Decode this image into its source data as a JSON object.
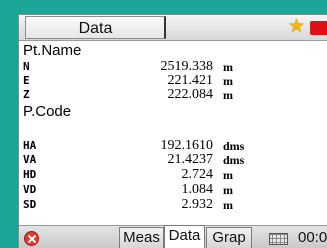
{
  "window": {
    "title": "Data"
  },
  "labels": {
    "pt_name": "Pt.Name",
    "p_code": "P.Code"
  },
  "coords": [
    {
      "key": "N",
      "value": "2519.338",
      "unit": "m"
    },
    {
      "key": "E",
      "value": "221.421",
      "unit": "m"
    },
    {
      "key": "Z",
      "value": "222.084",
      "unit": "m"
    }
  ],
  "measurements": [
    {
      "key": "HA",
      "value": "192.1610",
      "unit": "dms"
    },
    {
      "key": "VA",
      "value": "21.4237",
      "unit": "dms"
    },
    {
      "key": "HD",
      "value": "2.724",
      "unit": "m"
    },
    {
      "key": "VD",
      "value": "1.084",
      "unit": "m"
    },
    {
      "key": "SD",
      "value": "2.932",
      "unit": "m"
    }
  ],
  "tabs": [
    {
      "label": "Meas",
      "active": false
    },
    {
      "label": "Data",
      "active": true
    },
    {
      "label": "Grap",
      "active": false
    }
  ],
  "status": {
    "clock": "00:0"
  },
  "icons": {
    "favorite": "star-icon",
    "record": "record-icon",
    "close": "close-icon",
    "keyboard": "keyboard-icon"
  },
  "colors": {
    "background": "#1aa596",
    "star": "#f2b705",
    "record": "#e01018",
    "close": "#e23a2e"
  }
}
